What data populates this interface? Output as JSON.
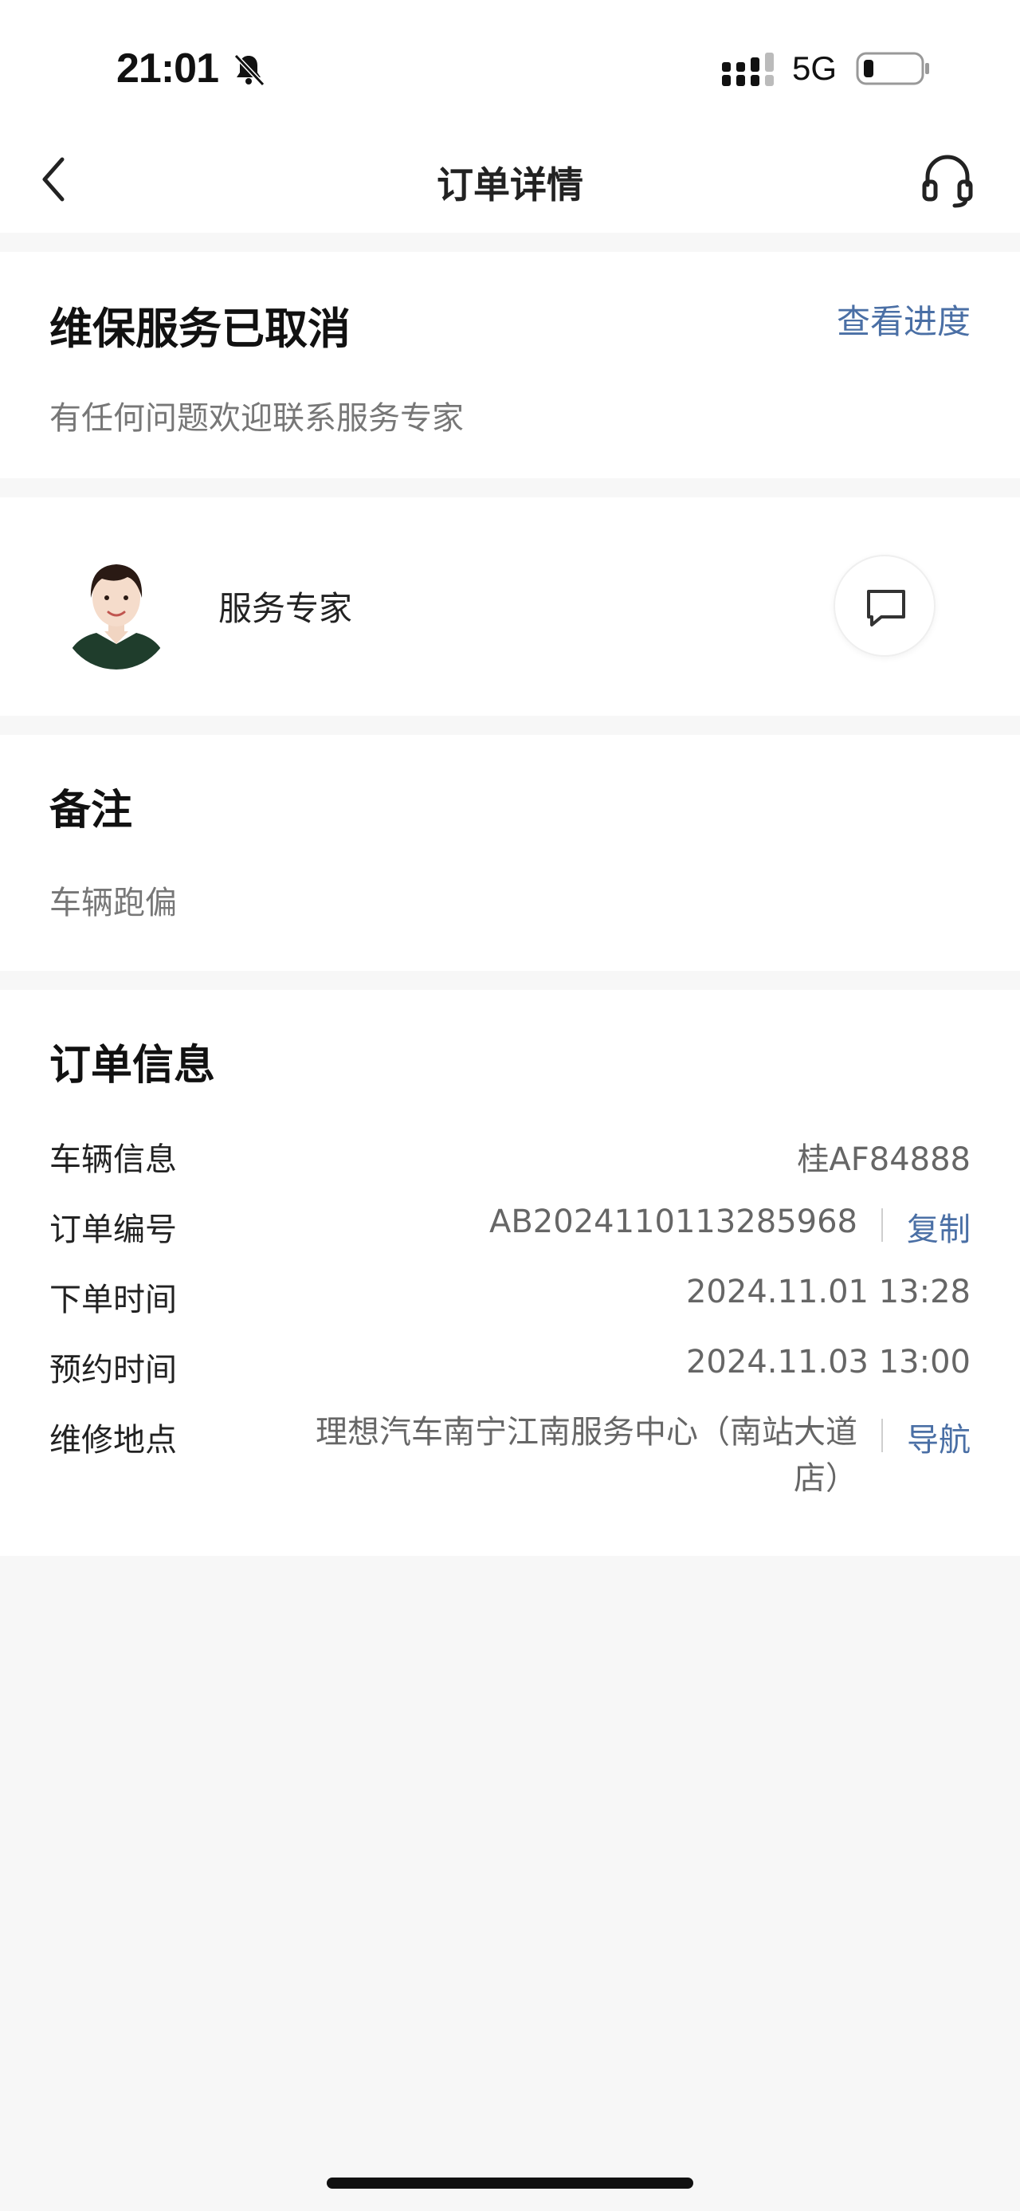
{
  "status_bar": {
    "time": "21:01",
    "network": "5G",
    "icons": [
      "bell-muted-icon",
      "signal-icon",
      "battery-icon"
    ]
  },
  "nav": {
    "title": "订单详情",
    "icons": [
      "back-icon",
      "headset-icon"
    ]
  },
  "status_card": {
    "title": "维保服务已取消",
    "progress_link": "查看进度",
    "subtitle": "有任何问题欢迎联系服务专家"
  },
  "expert_card": {
    "name": "服务专家",
    "icons": [
      "avatar",
      "chat-icon"
    ]
  },
  "remark_card": {
    "title": "备注",
    "text": "车辆跑偏"
  },
  "order_card": {
    "title": "订单信息",
    "rows": [
      {
        "label": "车辆信息",
        "value": "桂AF84888"
      },
      {
        "label": "订单编号",
        "value": "AB2024110113285968",
        "action": "复制"
      },
      {
        "label": "下单时间",
        "value": "2024.11.01 13:28"
      },
      {
        "label": "预约时间",
        "value": "2024.11.03 13:00"
      },
      {
        "label": "维修地点",
        "value": "理想汽车南宁江南服务中心（南站大道店）",
        "action": "导航"
      }
    ]
  },
  "colors": {
    "link": "#4a6fa5",
    "background": "#f7f7f7",
    "card": "#ffffff"
  }
}
